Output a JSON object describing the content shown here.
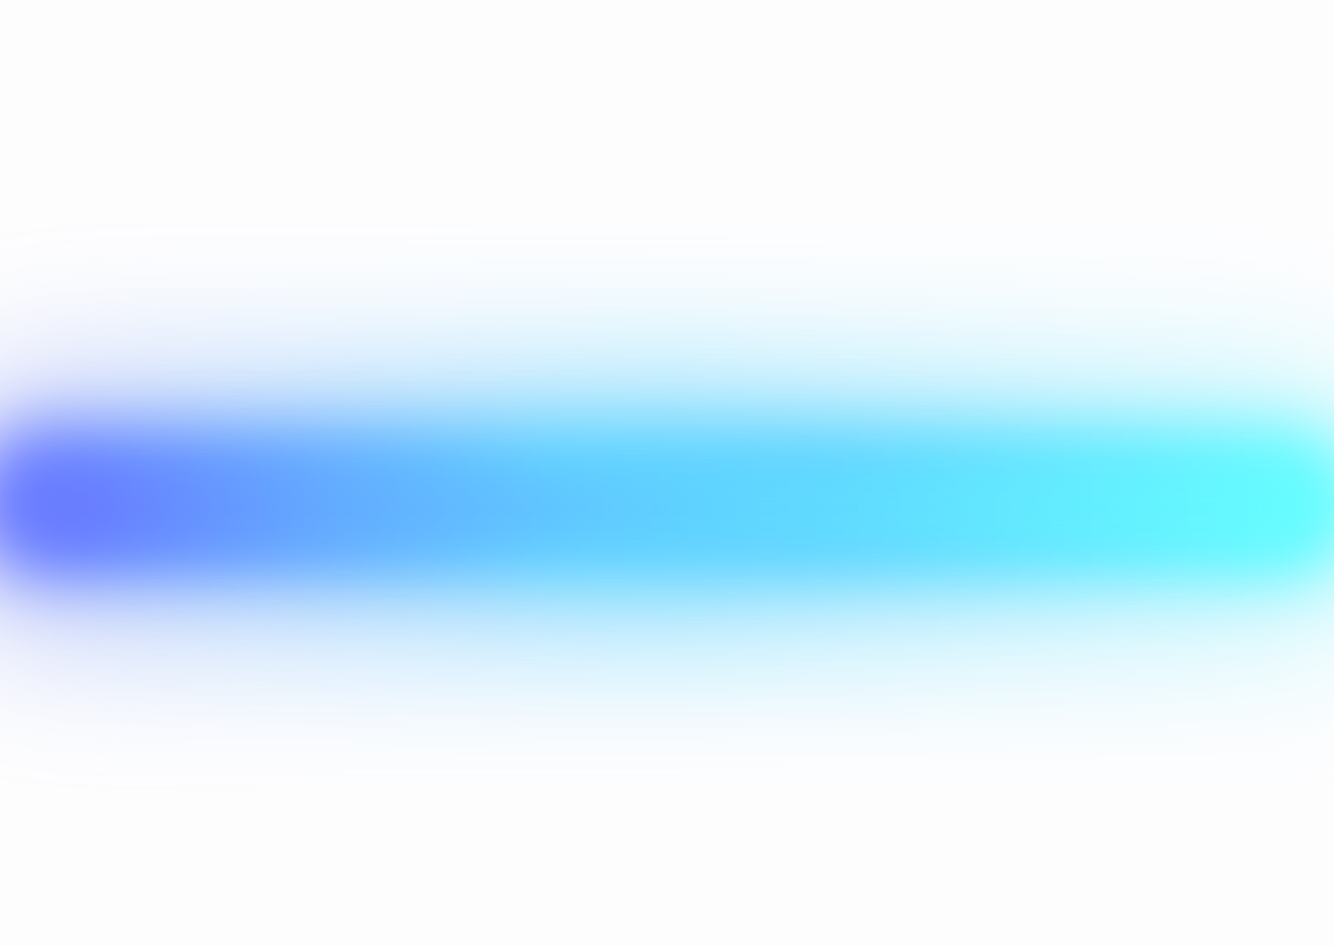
{
  "background": {
    "color": "#fdfdfe"
  },
  "glow": {
    "start_color": "#6a73ff",
    "middle_color": "#5fd3ff",
    "end_color": "#66ffff",
    "halo_start_color": "#b7b2f7",
    "halo_end_color": "#b8fbff"
  }
}
